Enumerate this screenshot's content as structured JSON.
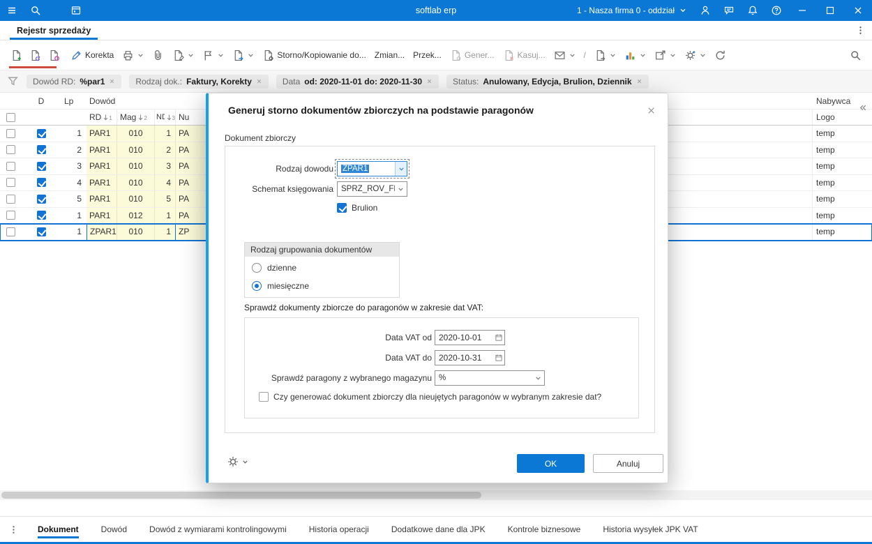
{
  "titlebar": {
    "app_title": "softlab erp",
    "company": "1 - Nasza firma 0 - oddział"
  },
  "doc_tabs": {
    "active": "Rejestr sprzedaży"
  },
  "toolbar": {
    "korekta": "Korekta",
    "storno": "Storno/Kopiowanie do...",
    "zmiana": "Zmian...",
    "przekaz": "Przek...",
    "generuj": "Gener...",
    "kasuj": "Kasuj...",
    "slash": "/"
  },
  "filter_bar": {
    "chips": [
      {
        "label": "Dowód  RD:",
        "value": "%par1"
      },
      {
        "label": "Rodzaj dok.:",
        "value": "Faktury, Korekty"
      },
      {
        "label": "Data",
        "value": "od: 2020-11-01  do: 2020-11-30"
      },
      {
        "label": "Status:",
        "value": "Anulowany, Edycja, Brulion, Dziennik"
      }
    ]
  },
  "grid": {
    "group_headers": {
      "dowod": "Dowód",
      "nabywca": "Nabywca"
    },
    "col_d": "D",
    "col_lp": "Lp",
    "columns": {
      "rd": "RD",
      "mag": "Mag",
      "nd": "ND",
      "nu": "Nu",
      "logo": "Logo"
    },
    "sort_indicators": {
      "rd": "1",
      "mag": "2",
      "nd": "3"
    },
    "rows": [
      {
        "checked": true,
        "lp": "1",
        "rd": "PAR1",
        "mag": "010",
        "nd": "1",
        "nu": "PA",
        "logo": "temp"
      },
      {
        "checked": true,
        "lp": "2",
        "rd": "PAR1",
        "mag": "010",
        "nd": "2",
        "nu": "PA",
        "logo": "temp"
      },
      {
        "checked": true,
        "lp": "3",
        "rd": "PAR1",
        "mag": "010",
        "nd": "3",
        "nu": "PA",
        "logo": "temp"
      },
      {
        "checked": true,
        "lp": "4",
        "rd": "PAR1",
        "mag": "010",
        "nd": "4",
        "nu": "PA",
        "logo": "temp"
      },
      {
        "checked": true,
        "lp": "5",
        "rd": "PAR1",
        "mag": "010",
        "nd": "5",
        "nu": "PA",
        "logo": "temp"
      },
      {
        "checked": true,
        "lp": "1",
        "rd": "PAR1",
        "mag": "012",
        "nd": "1",
        "nu": "PA",
        "logo": "temp"
      },
      {
        "checked": true,
        "lp": "1",
        "rd": "ZPAR1",
        "mag": "010",
        "nd": "1",
        "nu": "ZP",
        "logo": "temp",
        "selected": true
      }
    ]
  },
  "dialog": {
    "title": "Generuj storno dokumentów zbiorczych na podstawie paragonów",
    "section_label": "Dokument zbiorczy",
    "rodzaj_dowodu_label": "Rodzaj dowodu",
    "rodzaj_dowodu_value": "ZPAR1",
    "schemat_label": "Schemat księgowania",
    "schemat_value": "SPRZ_ROV_FK",
    "brulion_label": "Brulion",
    "grouping": {
      "title": "Rodzaj grupowania dokumentów",
      "option_daily": "dzienne",
      "option_monthly": "miesięczne",
      "selected": "miesięczne"
    },
    "vat": {
      "title": "Sprawdź dokumenty zbiorcze do paragonów w zakresie dat VAT:",
      "date_from_label": "Data VAT od",
      "date_from_value": "2020-10-01",
      "date_to_label": "Data VAT do",
      "date_to_value": "2020-10-31",
      "magazyn_label": "Sprawdź paragony z wybranego magazynu",
      "magazyn_value": "%",
      "generate_checkbox_label": "Czy generować dokument zbiorczy dla nieujętych paragonów w wybranym zakresie dat?",
      "generate_checkbox_checked": false
    },
    "ok_label": "OK",
    "cancel_label": "Anuluj"
  },
  "bottom_tabs": [
    "Dokument",
    "Dowód",
    "Dowód z wymiarami kontrolingowymi",
    "Historia operacji",
    "Dodatkowe dane dla JPK",
    "Kontrole biznesowe",
    "Historia wysyłek JPK VAT"
  ],
  "icons": {
    "titlebar": [
      "menu-icon",
      "search-icon",
      "app-icon",
      "chevron-down-icon",
      "person-icon",
      "chat-icon",
      "bell-icon",
      "help-icon",
      "minimize-icon",
      "maximize-icon",
      "close-icon"
    ],
    "toolbar": [
      "new-document-icon",
      "duplicate-document-icon",
      "preview-document-icon",
      "edit-pencil-icon",
      "print-icon",
      "attachment-icon",
      "document-pen-icon",
      "flag-icon",
      "document-arrow-icon",
      "document-gear-icon",
      "envelope-icon",
      "document-send-icon",
      "chart-icon",
      "window-export-icon",
      "gear-plus-icon",
      "refresh-icon",
      "search-icon"
    ],
    "other": [
      "filter-funnel-icon",
      "sort-indicator-icon",
      "calendar-icon",
      "collapse-panel-icon",
      "overflow-menu-icon",
      "gear-icon"
    ]
  },
  "colors": {
    "titlebar": "#0a78d4",
    "accent": "#0a78d4",
    "dialog_accent": "#18a0e8",
    "row_cell_highlight": "#fbfad9",
    "selection": "#2f86d6",
    "group_underline": "#cf4a3e"
  }
}
